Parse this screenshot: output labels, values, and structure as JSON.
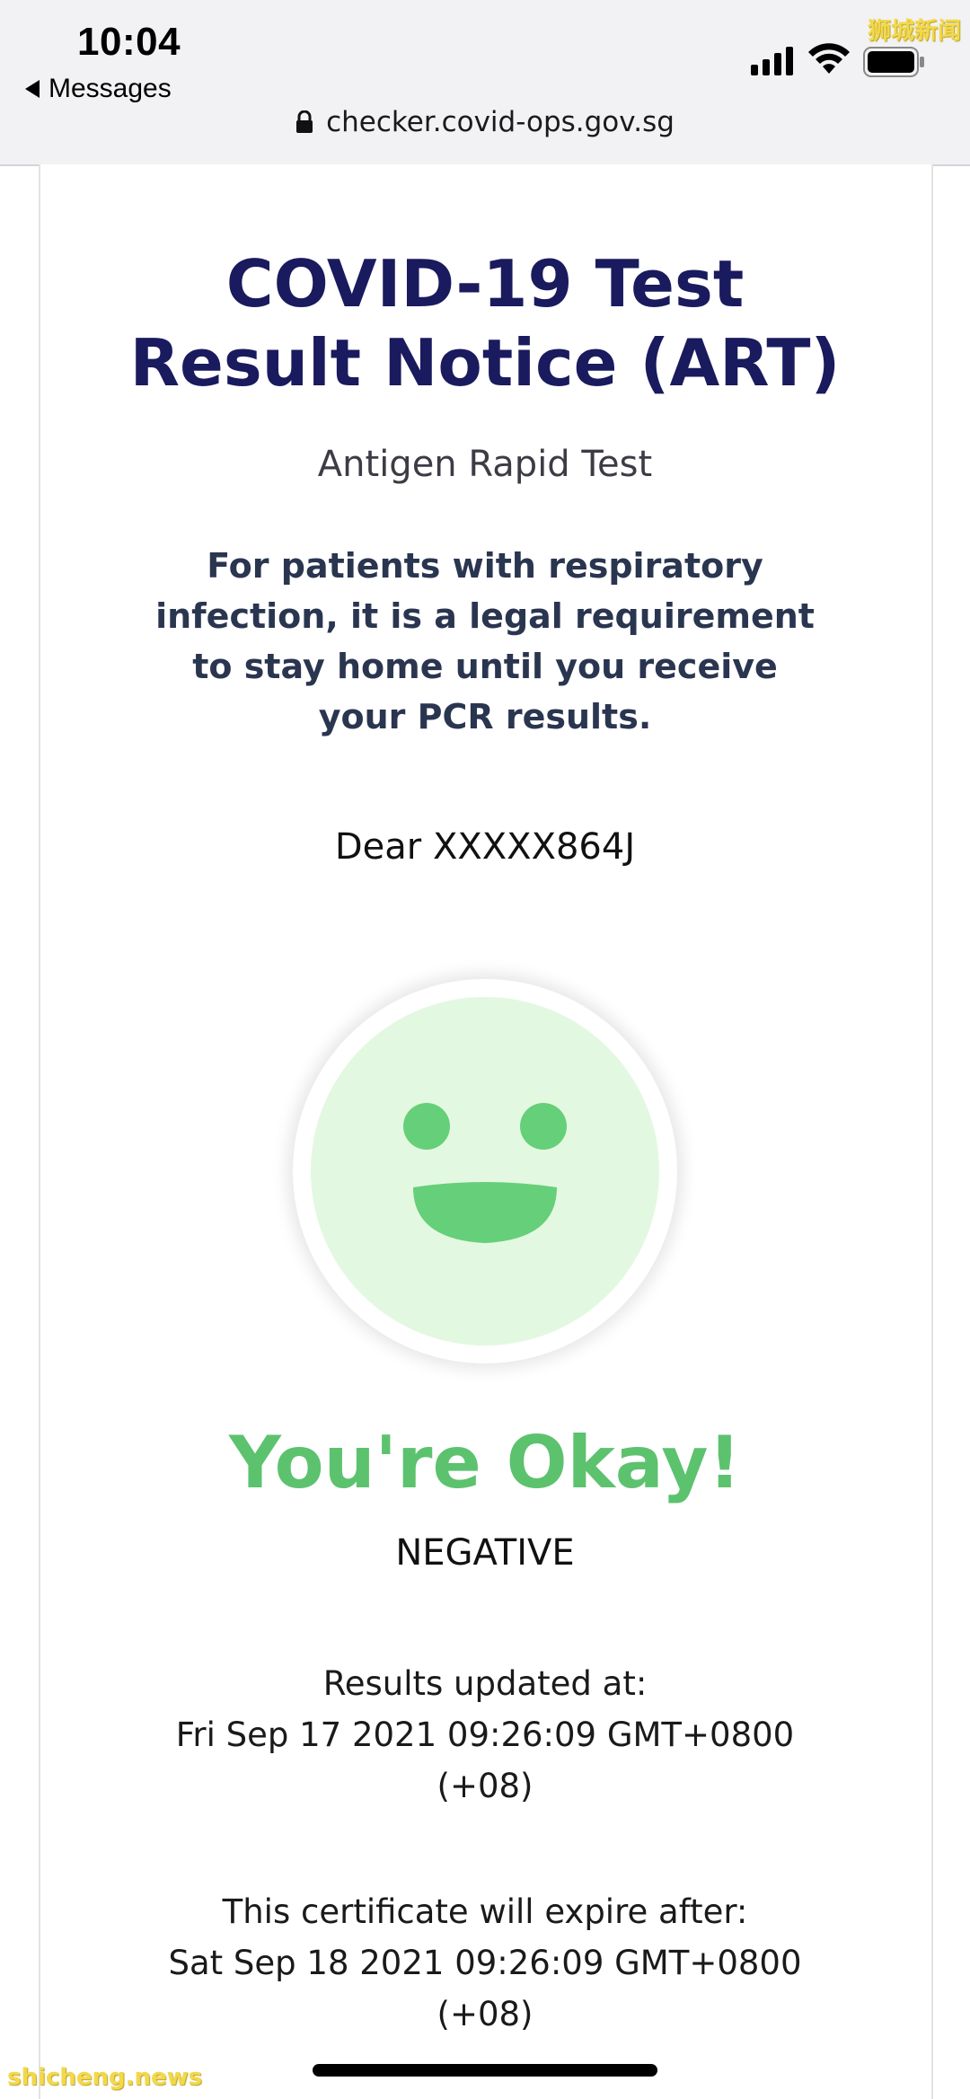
{
  "status_bar": {
    "time": "10:04",
    "back_label": "Messages"
  },
  "address_bar": {
    "url": "checker.covid-ops.gov.sg"
  },
  "page": {
    "title_line1": "COVID-19 Test",
    "title_line2": "Result Notice (ART)",
    "subtitle": "Antigen Rapid Test",
    "notice": "For patients with respiratory infection, it is a legal requirement to stay home until you receive your PCR results.",
    "greeting": "Dear XXXXX864J"
  },
  "result": {
    "icon": "smiley-face-icon",
    "headline": "You're Okay!",
    "status": "NEGATIVE",
    "updated_label": "Results updated at:",
    "updated_value": "Fri Sep 17 2021 09:26:09 GMT+0800",
    "updated_tz": "(+08)",
    "expiry_label": "This certificate will expire after:",
    "expiry_value": "Sat Sep 18 2021 09:26:09 GMT+0800",
    "expiry_tz": "(+08)"
  },
  "watermarks": {
    "top": "狮城新闻",
    "bottom": "shicheng.news"
  },
  "colors": {
    "title": "#1a1a5e",
    "notice": "#2a3550",
    "headline_green": "#5cc26e",
    "smiley_face": "#e3f8e0",
    "smiley_features": "#66cf79",
    "top_bar": "#f2f2f4"
  }
}
